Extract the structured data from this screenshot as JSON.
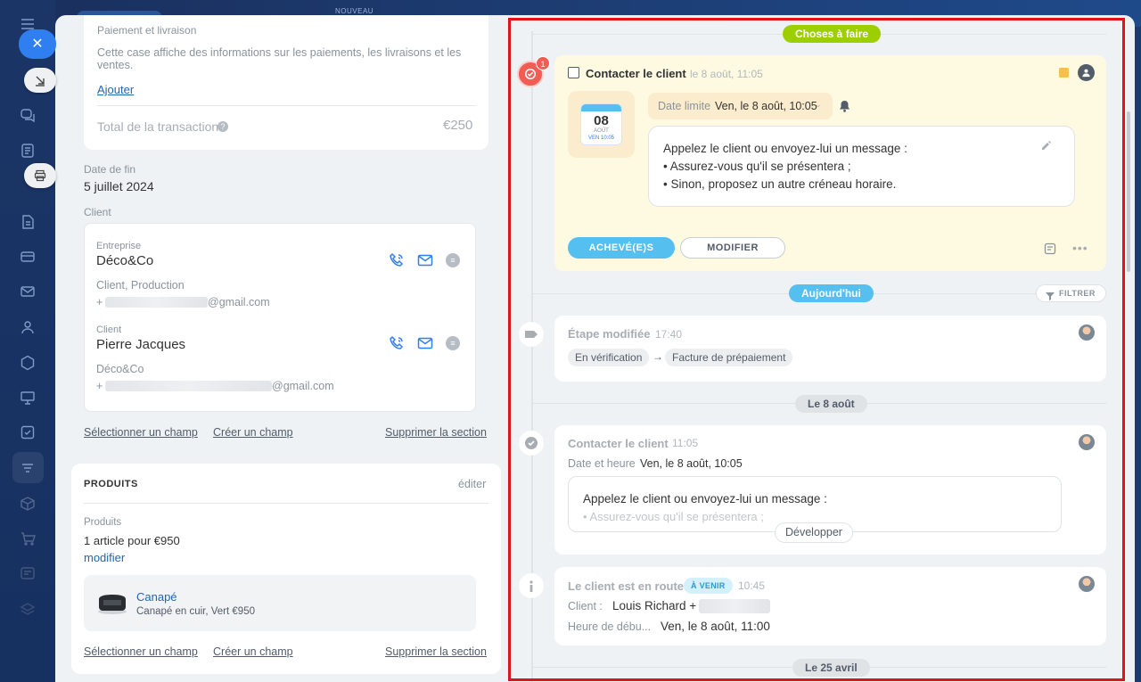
{
  "header": {
    "nouveau": "NOUVEAU"
  },
  "left": {
    "payment": {
      "label": "Paiement et livraison",
      "description": "Cette case affiche des informations sur les paiements, les livraisons et les ventes.",
      "add_link": "Ajouter",
      "total_label": "Total de la transaction",
      "total_value": "€250"
    },
    "end_date": {
      "label": "Date de fin",
      "value": "5 juillet 2024"
    },
    "client_label": "Client",
    "company": {
      "type_label": "Entreprise",
      "name": "Déco&Co",
      "subtitle": "Client, Production",
      "phone_prefix": "+",
      "email_suffix": "@gmail.com"
    },
    "contact": {
      "type_label": "Client",
      "name": "Pierre Jacques",
      "subtitle": "Déco&Co",
      "phone_prefix": "+",
      "email_suffix": "@gmail.com"
    },
    "section_links": {
      "select": "Sélectionner un champ",
      "create": "Créer un champ",
      "delete": "Supprimer la section"
    },
    "products": {
      "header": "PRODUITS",
      "edit": "éditer",
      "label": "Produits",
      "summary": "1 article pour €950",
      "modify": "modifier",
      "item_name": "Canapé",
      "item_desc": "Canapé en cuir, Vert  €950"
    }
  },
  "timeline": {
    "todo_pill": "Choses à faire",
    "badge_count": "1",
    "task": {
      "title": "Contacter le client",
      "time": "le 8 août, 11:05",
      "cal_day": "08",
      "cal_month": "AOÛT",
      "cal_sub": "VEN 10:05",
      "deadline_label": "Date limite",
      "deadline_value": "Ven, le 8 août, 10:05",
      "message_line1": "Appelez le client ou envoyez-lui un message :",
      "message_line2": "• Assurez-vous qu'il se présentera ;",
      "message_line3": "• Sinon, proposez un autre créneau horaire.",
      "done_btn": "ACHEVÉ(E)S",
      "modify_btn": "MODIFIER"
    },
    "today_pill": "Aujourd'hui",
    "filter": "FILTRER",
    "stage": {
      "title": "Étape modifiée",
      "time": "17:40",
      "from": "En vérification",
      "arrow": "→",
      "to": "Facture de prépaiement"
    },
    "aug8_pill": "Le 8 août",
    "contact_done": {
      "title": "Contacter le client",
      "time": "11:05",
      "date_label": "Date et heure",
      "date_value": "Ven, le 8 août, 10:05",
      "msg1": "Appelez le client ou envoyez-lui un message :",
      "msg2": "• Assurez-vous qu'il se présentera ;",
      "expand": "Développer"
    },
    "en_route": {
      "title": "Le client est en route",
      "badge": "À VENIR",
      "time": "10:45",
      "client_label": "Client :",
      "client_value": "Louis Richard +",
      "start_label": "Heure de débu...",
      "start_value": "Ven, le 8 août, 11:00"
    },
    "apr25_pill": "Le 25 avril"
  },
  "colors": {
    "accent": "#2f7ff0",
    "todo_green": "#9dcf00",
    "today_blue": "#55bff0",
    "highlight_red": "#e0131a",
    "task_bg": "#fefae2"
  }
}
